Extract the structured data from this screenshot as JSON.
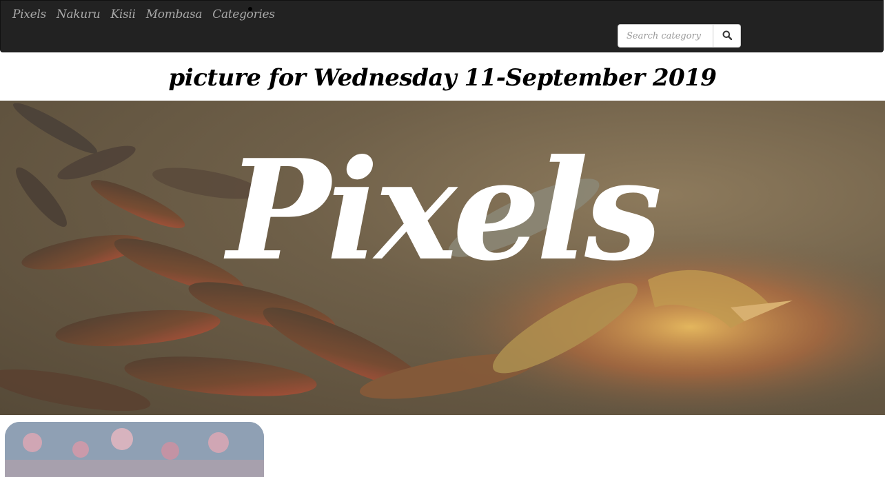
{
  "navbar": {
    "links": [
      "Pixels",
      "Nakuru",
      "Kisii",
      "Mombasa",
      "Categories"
    ],
    "search": {
      "placeholder": "Search category",
      "value": ""
    },
    "search_icon": "search-icon"
  },
  "main": {
    "date_heading": "picture for Wednesday 11-September 2019",
    "hero_title": "Pixels"
  },
  "colors": {
    "navbar_bg": "#222222",
    "nav_link": "#a8a8a8",
    "hero_text": "#ffffff"
  }
}
